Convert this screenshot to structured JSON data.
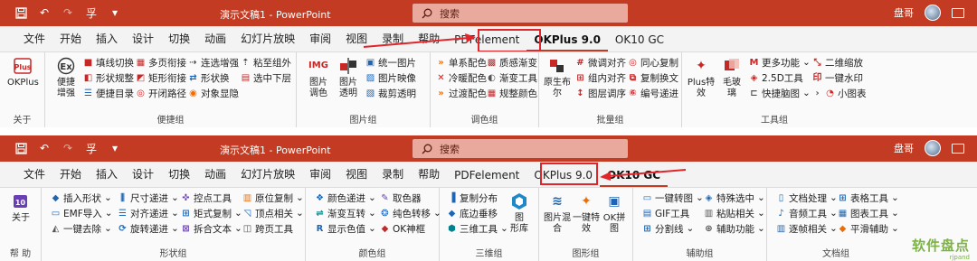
{
  "window1": {
    "title": "演示文稿1 - PowerPoint",
    "search": "搜索",
    "user": "盘哥",
    "tabs": [
      "文件",
      "开始",
      "插入",
      "设计",
      "切换",
      "动画",
      "幻灯片放映",
      "审阅",
      "视图",
      "录制",
      "帮助",
      "PDFelement",
      "OKPlus 9.0",
      "OK10 GC"
    ],
    "active_tab": "OKPlus 9.0",
    "groups": {
      "about": "关于",
      "convenient": "便捷组",
      "image": "图片组",
      "color": "调色组",
      "batch": "批量组",
      "tools": "工具组"
    },
    "buttons": {
      "okplus": "OKPlus",
      "enhance": [
        "便捷",
        "增强"
      ],
      "fill_line": "填线切换",
      "shape_spec": "形状规整",
      "quick_toc": "便捷目录",
      "multi_page": "多页衔接",
      "rect_join": "矩形衔接",
      "open_path": "开闭路径",
      "conn_enhance": "连选增强",
      "shape_swap": "形状换",
      "obj_hide": "对象显隐",
      "paste_outside": "粘至组外",
      "select_layer": "选中下层",
      "img_color": [
        "图片",
        "调色"
      ],
      "img_trans": [
        "图片",
        "透明"
      ],
      "unify_img": "统一图片",
      "img_mirror": "图片映像",
      "crop_trans": "裁剪透明",
      "single_color": "单系配色",
      "cool_warm": "冷暖配色",
      "transition_color": "过渡配色",
      "texture_grad": "质感渐变",
      "grad_tool": "渐变工具",
      "spec_color": "规整颜色",
      "origin_distrib": [
        "原生布",
        "尔"
      ],
      "fine_align": "微调对齐",
      "group_align": "组内对齐",
      "layer_order": "图层调序",
      "same_copy": "同心复制",
      "copy_swap": "复制换文",
      "number_seq": "编号递进",
      "plus_effect": [
        "Plus特",
        "效"
      ],
      "frosted": [
        "毛玻",
        "璃"
      ],
      "more_func": "更多功能",
      "tool_25d": "2.5D工具",
      "quick_brain": "快捷脑图",
      "secondary_zoom": "二维缩放",
      "one_watermark": "一键水印",
      "mini_chart": "小图表"
    }
  },
  "window2": {
    "title": "演示文稿1 - PowerPoint",
    "search": "搜索",
    "user": "盘哥",
    "tabs": [
      "文件",
      "开始",
      "插入",
      "设计",
      "切换",
      "动画",
      "幻灯片放映",
      "审阅",
      "视图",
      "录制",
      "帮助",
      "PDFelement",
      "OKPlus 9.0",
      "OK10 GC"
    ],
    "active_tab": "OK10 GC",
    "groups": {
      "help": "帮 助",
      "shape": "形状组",
      "color": "颜色组",
      "threed": "三维组",
      "graphic": "图形组",
      "aux": "辅助组",
      "doc": "文档组"
    },
    "buttons": {
      "about": "关于",
      "insert_shape": "插入形状",
      "emf_import": "EMF导入",
      "one_remove": "一键去除",
      "size_step": "尺寸递进",
      "align_step": "对齐递进",
      "rotate_step": "旋转递进",
      "ctrl_tool": "控点工具",
      "matrix_copy": "矩式复制",
      "split_text": "拆合文本",
      "origin_copy": "原位复制",
      "vertex_related": "顶点相关",
      "cross_page": "跨页工具",
      "color_step": "颜色递进",
      "grad_swap": "渐变互转",
      "show_color": "显示色值",
      "picker": "取色器",
      "pure_swap": "纯色转移",
      "ok_sphere": "OK神框",
      "copy_distrib": "复制分布",
      "bottom_move": "底边垂移",
      "threed_tool": "三维工具",
      "graphic_lib": [
        "图",
        "形库"
      ],
      "img_mix": [
        "图片混",
        "合"
      ],
      "one_effect": [
        "一键特",
        "效"
      ],
      "ok_collage": [
        "OK拼",
        "图"
      ],
      "one_convert": "一键转图",
      "gif_tool": "GIF工具",
      "split_line": "分割线",
      "special_select": "特殊选中",
      "paste_related": "粘贴相关",
      "aux_func": "辅助功能",
      "doc_process": "文档处理",
      "audio_tool": "音频工具",
      "frame_related": "逐帧相关",
      "table_tool": "表格工具",
      "chart_tool": "图表工具",
      "smooth_aux": "平滑辅助"
    }
  },
  "logo": {
    "text": "软件盘点",
    "sub": "rjpand"
  }
}
